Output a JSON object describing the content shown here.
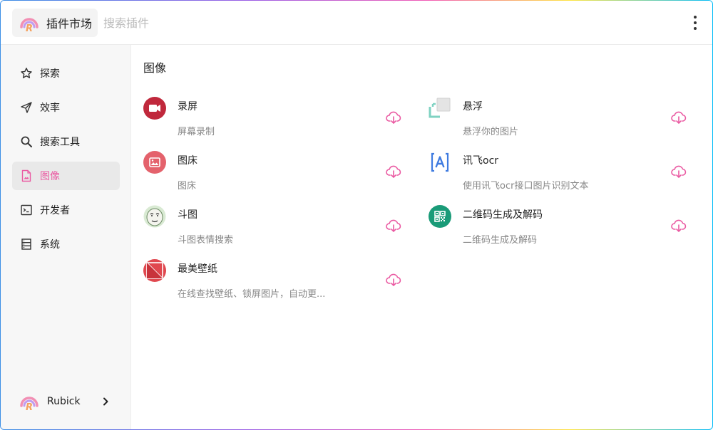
{
  "header": {
    "app_title": "插件市场",
    "search_placeholder": "搜索插件",
    "logo_icon": "rubick-logo-icon",
    "more_icon": "more-vertical-icon"
  },
  "sidebar": {
    "items": [
      {
        "label": "探索",
        "icon": "star-icon",
        "active": false
      },
      {
        "label": "效率",
        "icon": "send-icon",
        "active": false
      },
      {
        "label": "搜索工具",
        "icon": "search-icon",
        "active": false
      },
      {
        "label": "图像",
        "icon": "image-file-icon",
        "active": true
      },
      {
        "label": "开发者",
        "icon": "terminal-icon",
        "active": false
      },
      {
        "label": "系统",
        "icon": "database-icon",
        "active": false
      }
    ],
    "user": {
      "name": "Rubick",
      "icon": "rubick-logo-icon"
    }
  },
  "main": {
    "section_title": "图像",
    "plugins": [
      {
        "name": "录屏",
        "desc": "屏幕录制",
        "icon": "video-camera-icon"
      },
      {
        "name": "悬浮",
        "desc": "悬浮你的图片",
        "icon": "float-window-icon"
      },
      {
        "name": "图床",
        "desc": "图床",
        "icon": "image-host-icon"
      },
      {
        "name": "讯飞ocr",
        "desc": "使用讯飞ocr接口图片识别文本",
        "icon": "ocr-icon"
      },
      {
        "name": "斗图",
        "desc": "斗图表情搜索",
        "icon": "meme-face-icon"
      },
      {
        "name": "二维码生成及解码",
        "desc": "二维码生成及解码",
        "icon": "qrcode-icon"
      },
      {
        "name": "最美壁纸",
        "desc": "在线查找壁纸、锁屏图片，自动更...",
        "icon": "wallpaper-icon"
      }
    ],
    "download_icon": "cloud-download-icon"
  },
  "colors": {
    "accent": "#ea5aa2",
    "sidebar_bg": "#f7f7f7",
    "active_bg": "#e9e9e9"
  }
}
